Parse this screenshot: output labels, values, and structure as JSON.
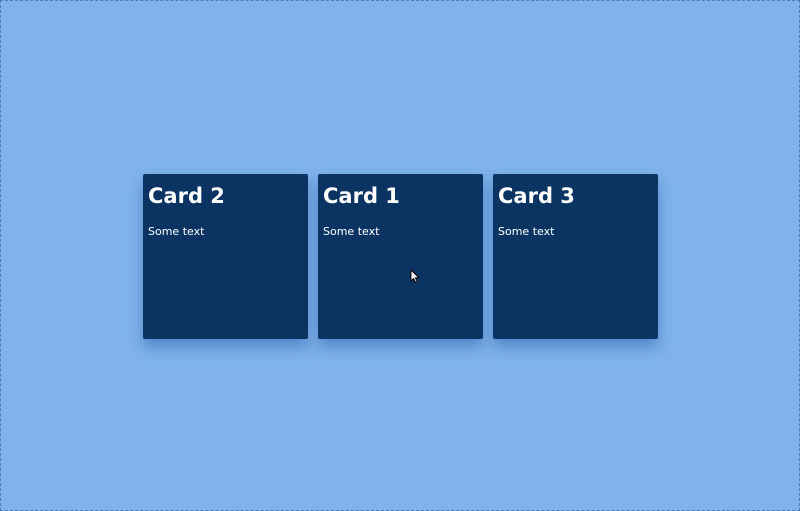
{
  "cards": [
    {
      "title": "Card 2",
      "text": "Some text"
    },
    {
      "title": "Card 1",
      "text": "Some text"
    },
    {
      "title": "Card 3",
      "text": "Some text"
    }
  ],
  "colors": {
    "background": "#7fb3ea",
    "card": "#0c3462",
    "text": "#ffffff"
  },
  "cursor": {
    "icon": "mouse-pointer-icon"
  }
}
